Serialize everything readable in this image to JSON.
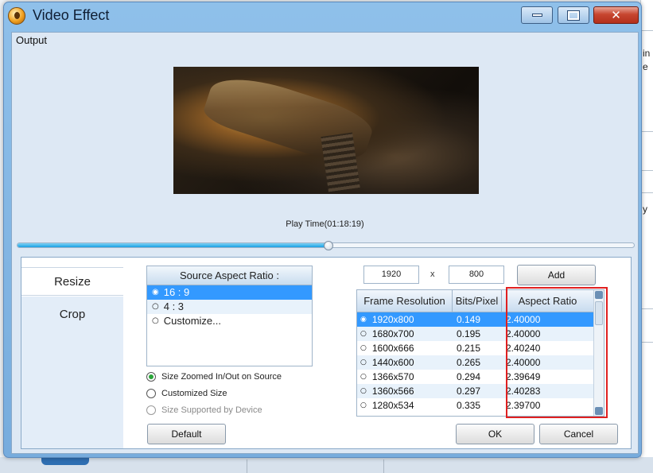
{
  "window": {
    "title": "Video Effect"
  },
  "output": {
    "label": "Output",
    "play_time": "Play Time(01:18:19)",
    "progress": 0.505
  },
  "tabs": [
    {
      "label": "Resize"
    },
    {
      "label": "Crop"
    }
  ],
  "source_aspect": {
    "header": "Source Aspect Ratio :",
    "options": [
      {
        "label": "16 : 9",
        "selected": true
      },
      {
        "label": "4 : 3",
        "selected": false
      },
      {
        "label": "Customize...",
        "selected": false
      }
    ]
  },
  "size_options": [
    {
      "label": "Size Zoomed In/Out on Source",
      "checked": true,
      "enabled": true
    },
    {
      "label": "Customized Size",
      "checked": false,
      "enabled": true
    },
    {
      "label": "Size Supported by Device",
      "checked": false,
      "enabled": false
    }
  ],
  "dimensions": {
    "width": "1920",
    "separator": "x",
    "height": "800",
    "add_label": "Add"
  },
  "resolution_table": {
    "columns": [
      "Frame Resolution",
      "Bits/Pixel",
      "Aspect Ratio"
    ],
    "rows": [
      {
        "res": "1920x800",
        "bits": "0.149",
        "ratio": "2.40000",
        "selected": true
      },
      {
        "res": "1680x700",
        "bits": "0.195",
        "ratio": "2.40000"
      },
      {
        "res": "1600x666",
        "bits": "0.215",
        "ratio": "2.40240"
      },
      {
        "res": "1440x600",
        "bits": "0.265",
        "ratio": "2.40000"
      },
      {
        "res": "1366x570",
        "bits": "0.294",
        "ratio": "2.39649"
      },
      {
        "res": "1360x566",
        "bits": "0.297",
        "ratio": "2.40283"
      },
      {
        "res": "1280x534",
        "bits": "0.335",
        "ratio": "2.39700"
      }
    ]
  },
  "buttons": {
    "default": "Default",
    "ok": "OK",
    "cancel": "Cancel"
  },
  "background_app": {
    "fragments": [
      "in",
      "e",
      "y"
    ]
  },
  "colors": {
    "accent": "#3399ff",
    "highlight": "#e02020",
    "progress": "#1aa0e2"
  }
}
